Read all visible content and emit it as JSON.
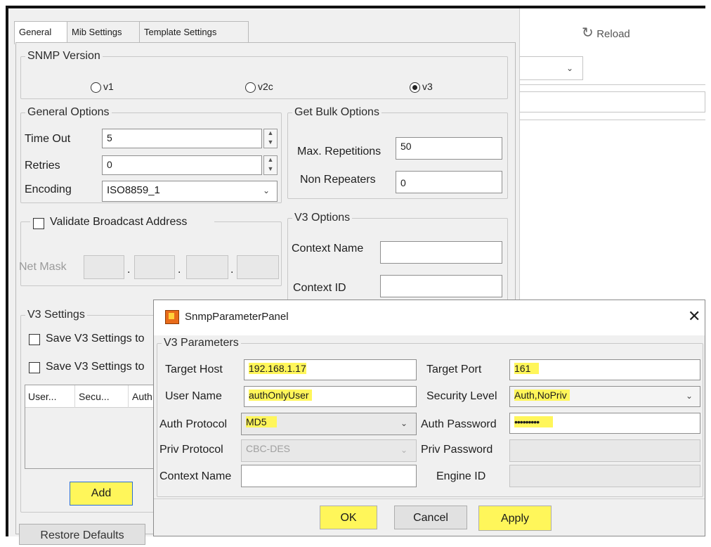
{
  "tabs": [
    "General",
    "Mib Settings",
    "Template Settings"
  ],
  "toolbar": {
    "reload_label": "Reload"
  },
  "snmp_version": {
    "legend": "SNMP Version",
    "options": [
      "v1",
      "v2c",
      "v3"
    ],
    "selected": "v3"
  },
  "general_options": {
    "legend": "General Options",
    "timeout_label": "Time Out",
    "timeout_value": "5",
    "retries_label": "Retries",
    "retries_value": "0",
    "encoding_label": "Encoding",
    "encoding_value": "ISO8859_1"
  },
  "get_bulk": {
    "legend": "Get Bulk Options",
    "max_rep_label": "Max. Repetitions",
    "max_rep_value": "50",
    "non_rep_label": "Non Repeaters",
    "non_rep_value": "0"
  },
  "broadcast": {
    "legend": "Validate Broadcast Address",
    "netmask_label": "Net Mask"
  },
  "v3_options": {
    "legend": "V3 Options",
    "context_name_label": "Context Name",
    "context_id_label": "Context ID"
  },
  "v3_settings": {
    "legend": "V3 Settings",
    "save1": "Save V3 Settings to",
    "save2": "Save V3 Settings to",
    "columns": [
      "User...",
      "Secu...",
      "Auth..."
    ],
    "add_label": "Add",
    "restore_label": "Restore Defaults"
  },
  "dialog": {
    "title": "SnmpParameterPanel",
    "group": "V3 Parameters",
    "target_host_label": "Target Host",
    "target_host": "192.168.1.17",
    "target_port_label": "Target Port",
    "target_port": "161",
    "user_name_label": "User Name",
    "user_name": "authOnlyUser",
    "security_level_label": "Security Level",
    "security_level": "Auth,NoPriv",
    "auth_protocol_label": "Auth Protocol",
    "auth_protocol": "MD5",
    "auth_password_label": "Auth Password",
    "auth_password": "•••••••••",
    "priv_protocol_label": "Priv Protocol",
    "priv_protocol": "CBC-DES",
    "priv_password_label": "Priv Password",
    "context_name_label": "Context Name",
    "engine_id_label": "Engine ID",
    "ok_label": "OK",
    "cancel_label": "Cancel",
    "apply_label": "Apply"
  },
  "colors": {
    "highlight": "#fff65a",
    "panel_bg": "#f0f0f0"
  }
}
